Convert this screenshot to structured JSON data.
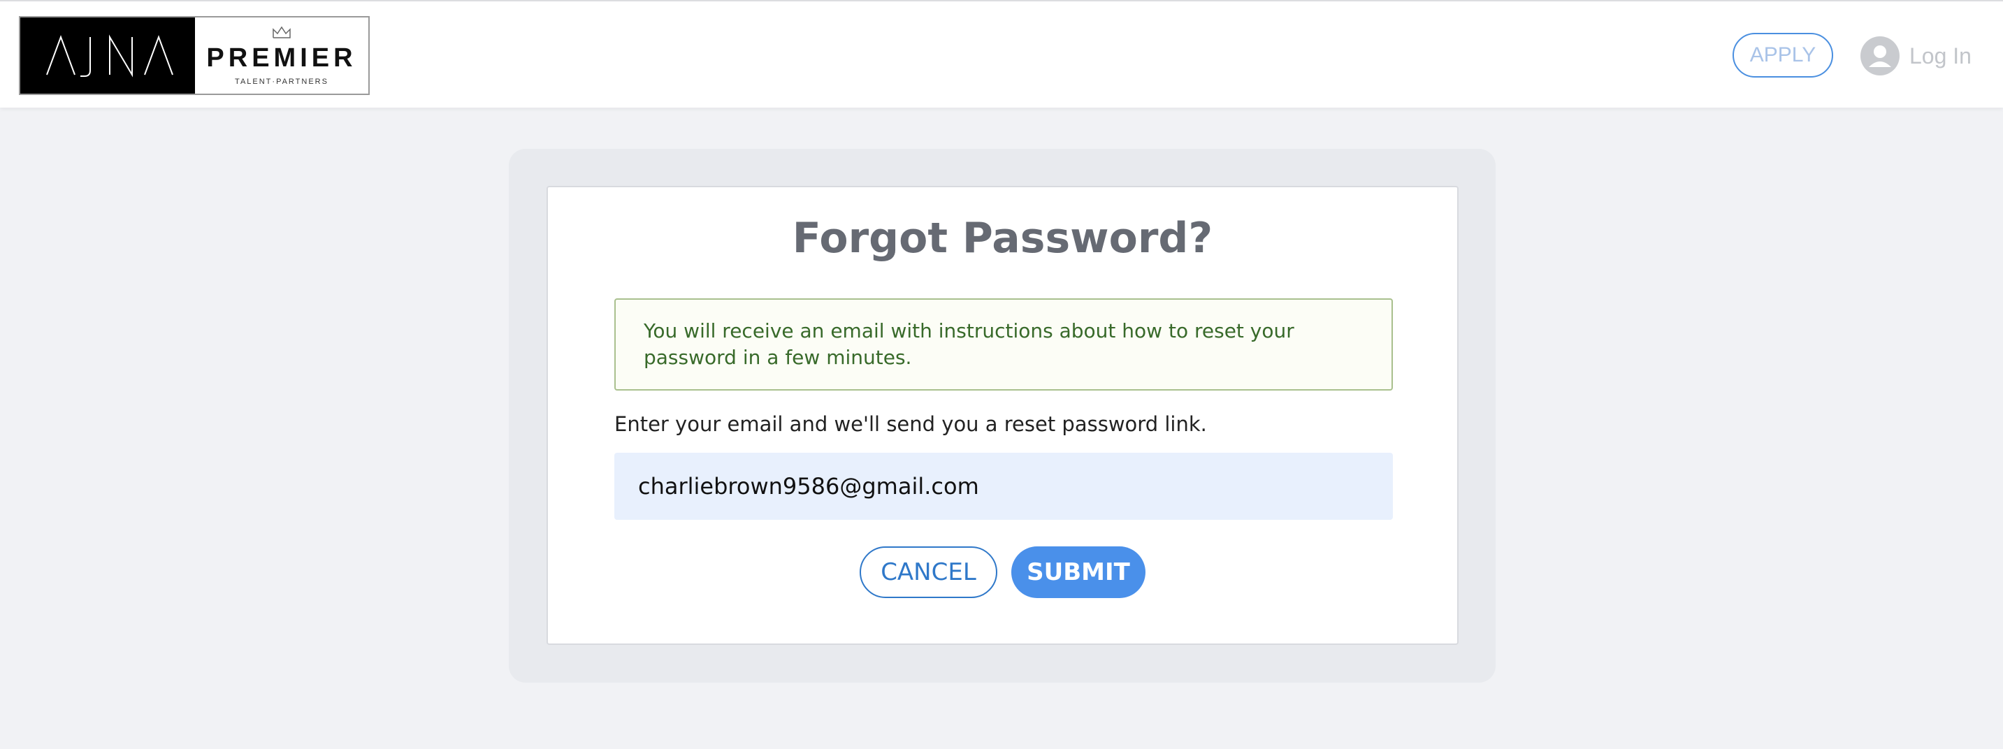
{
  "header": {
    "logo": {
      "left_text": "AJNA",
      "brand": "PREMIER",
      "tagline": "TALENT·PARTNERS",
      "crown_icon": "crown-icon"
    },
    "apply_label": "APPLY",
    "login_label": "Log In",
    "avatar_icon": "user-avatar-icon"
  },
  "form": {
    "title": "Forgot Password?",
    "alert_message": "You will receive an email with instructions about how to reset your password in a few minutes.",
    "instruction": "Enter your email and we'll send you a reset password link.",
    "email_value": "charliebrown9586@gmail.com",
    "cancel_label": "CANCEL",
    "submit_label": "SUBMIT"
  },
  "colors": {
    "accent": "#4a90ea",
    "alert_text": "#386a2a",
    "alert_border": "#a9c08e",
    "page_background": "#f1f2f5"
  }
}
